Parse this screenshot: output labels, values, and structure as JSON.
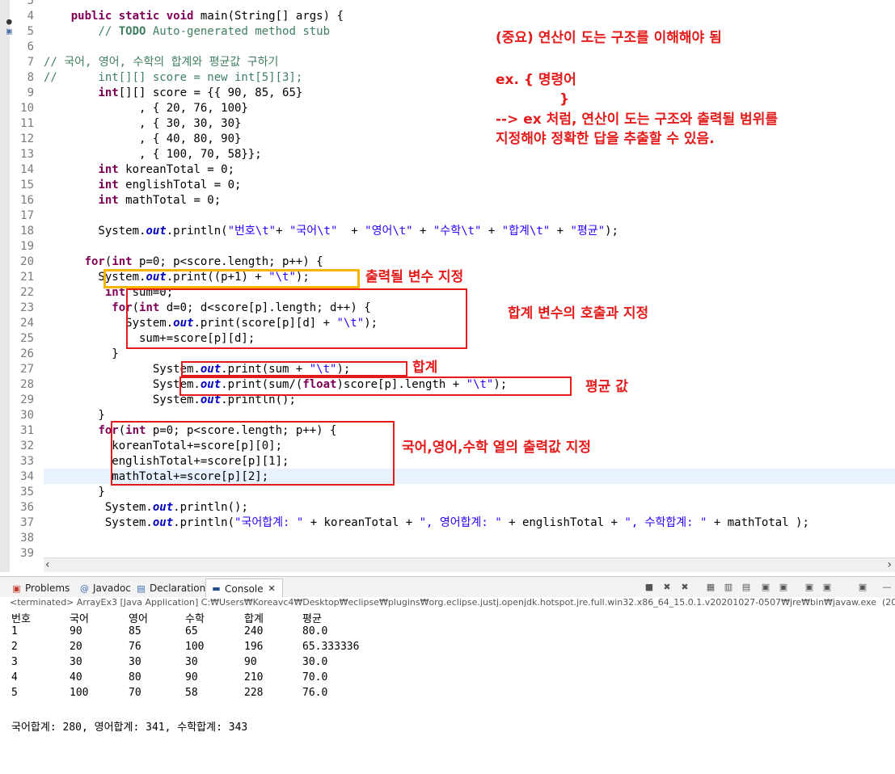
{
  "editor": {
    "lines": [
      {
        "n": "5",
        "t": ""
      },
      {
        "n": "4",
        "t": "    <span class=\"kw\">public</span> <span class=\"kw\">static</span> <span class=\"kw\">void</span> main(String[] args) {"
      },
      {
        "n": "5",
        "t": "        <span class=\"cm\">// <b>TODO</b> Auto-generated method stub</span>"
      },
      {
        "n": "6",
        "t": ""
      },
      {
        "n": "7",
        "t": "<span class=\"cm\">// 국어, 영어, 수학의 합계와 평균값 구하기</span>"
      },
      {
        "n": "8",
        "t": "<span class=\"cm\">//      int[][] score = new int[5][3];</span>"
      },
      {
        "n": "9",
        "t": "        <span class=\"kw\">int</span>[][] score = {{ 90, 85, 65}"
      },
      {
        "n": "10",
        "t": "              , { 20, 76, 100}"
      },
      {
        "n": "11",
        "t": "              , { 30, 30, 30}"
      },
      {
        "n": "12",
        "t": "              , { 40, 80, 90}"
      },
      {
        "n": "13",
        "t": "              , { 100, 70, 58}};"
      },
      {
        "n": "14",
        "t": "        <span class=\"kw\">int</span> koreanTotal = 0;"
      },
      {
        "n": "15",
        "t": "        <span class=\"kw\">int</span> englishTotal = 0;"
      },
      {
        "n": "16",
        "t": "        <span class=\"kw\">int</span> mathTotal = 0;"
      },
      {
        "n": "17",
        "t": ""
      },
      {
        "n": "18",
        "t": "        System.<span class=\"out\">out</span>.println(<span class=\"str\">\"번호\\t\"</span>+ <span class=\"str\">\"국어\\t\"</span>  + <span class=\"str\">\"영어\\t\"</span> + <span class=\"str\">\"수학\\t\"</span> + <span class=\"str\">\"합계\\t\"</span> + <span class=\"str\">\"평균\"</span>);"
      },
      {
        "n": "19",
        "t": ""
      },
      {
        "n": "20",
        "t": "      <span class=\"kw\">for</span>(<span class=\"kw\">int</span> p=0; p&lt;score.length; p++) {"
      },
      {
        "n": "21",
        "t": "        System.<span class=\"out\">out</span>.print((p+1) + <span class=\"str\">\"\\t\"</span>);"
      },
      {
        "n": "22",
        "t": "         <span class=\"kw\">int</span> sum=0;"
      },
      {
        "n": "23",
        "t": "          <span class=\"kw\">for</span>(<span class=\"kw\">int</span> d=0; d&lt;score[p].length; d++) {"
      },
      {
        "n": "24",
        "t": "            System.<span class=\"out\">out</span>.print(score[p][d] + <span class=\"str\">\"\\t\"</span>);"
      },
      {
        "n": "25",
        "t": "              sum+=score[p][d];"
      },
      {
        "n": "26",
        "t": "          }"
      },
      {
        "n": "27",
        "t": "                System.<span class=\"out\">out</span>.print(sum + <span class=\"str\">\"\\t\"</span>);"
      },
      {
        "n": "28",
        "t": "                System.<span class=\"out\">out</span>.print(sum/(<span class=\"kw\">float</span>)score[p].length + <span class=\"str\">\"\\t\"</span>);"
      },
      {
        "n": "29",
        "t": "                System.<span class=\"out\">out</span>.println();"
      },
      {
        "n": "30",
        "t": "        }"
      },
      {
        "n": "31",
        "t": "        <span class=\"kw\">for</span>(<span class=\"kw\">int</span> p=0; p&lt;score.length; p++) {"
      },
      {
        "n": "32",
        "t": "          koreanTotal+=score[p][0];"
      },
      {
        "n": "33",
        "t": "          englishTotal+=score[p][1];"
      },
      {
        "n": "34",
        "t": "          mathTotal+=score[p][2];"
      },
      {
        "n": "35",
        "t": "        }"
      },
      {
        "n": "36",
        "t": "         System.<span class=\"out\">out</span>.println();"
      },
      {
        "n": "37",
        "t": "         System.<span class=\"out\">out</span>.println(<span class=\"str\">\"국어합계: \"</span> + koreanTotal + <span class=\"str\">\", 영어합계: \"</span> + englishTotal + <span class=\"str\">\", 수학합계: \"</span> + mathTotal );"
      },
      {
        "n": "38",
        "t": ""
      },
      {
        "n": "39",
        "t": ""
      }
    ]
  },
  "annotations": {
    "note1": "(중요) 연산이 도는 구조를 이해해야 됨",
    "note2": "ex. { 명령어",
    "note3": "}",
    "note4": "--> ex 처럼, 연산이 도는 구조와 출력될 범위를",
    "note5": "지정해야 정확한 답을 추출할 수 있음.",
    "print_var": "출력될 변수 지정",
    "sum_call": "합계 변수의 호출과 지정",
    "sum": "합계",
    "avg": "평균 값",
    "col_totals": "국어,영어,수학 열의 출력값 지정"
  },
  "tabs": {
    "problems": "Problems",
    "javadoc": "Javadoc",
    "declaration": "Declaration",
    "console": "Console"
  },
  "console": {
    "terminated": "<terminated> ArrayEx3 [Java Application] C:₩Users₩Koreavc4₩Desktop₩eclipse₩plugins₩org.eclipse.justj.openjdk.hotspot.jre.full.win32.x86_64_15.0.1.v20201027-0507₩jre₩bin₩javaw.exe  (2023. 10. 1",
    "headers": [
      "번호",
      "국어",
      "영어",
      "수학",
      "합계",
      "평균"
    ],
    "rows": [
      [
        "1",
        "90",
        "85",
        "65",
        "240",
        "80.0"
      ],
      [
        "2",
        "20",
        "76",
        "100",
        "196",
        "65.333336"
      ],
      [
        "3",
        "30",
        "30",
        "30",
        "90",
        "30.0"
      ],
      [
        "4",
        "40",
        "80",
        "90",
        "210",
        "70.0"
      ],
      [
        "5",
        "100",
        "70",
        "58",
        "228",
        "76.0"
      ]
    ],
    "totals": "국어합계: 280, 영어합계: 341, 수학합계: 343"
  },
  "colors": {
    "annotation_red": "#e41b1b",
    "annotation_yellow": "#f7b500",
    "keyword": "#7f0055",
    "string": "#2a00ff",
    "comment": "#3f7f5f",
    "field": "#0000c0"
  }
}
